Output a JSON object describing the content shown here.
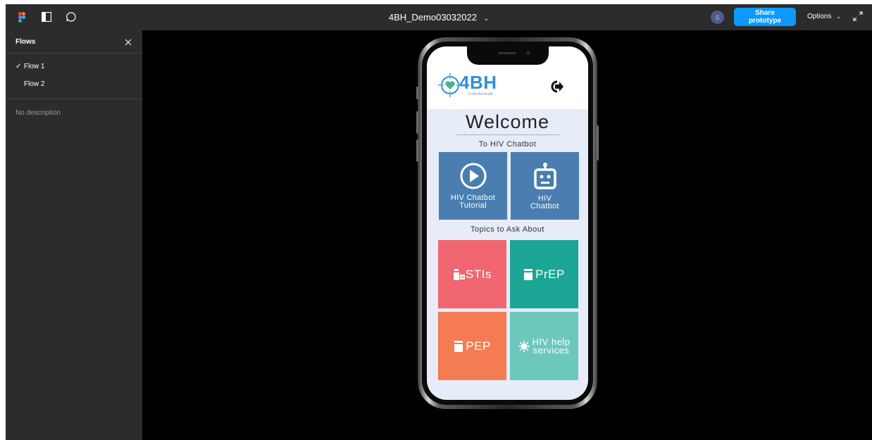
{
  "topbar": {
    "file_title": "4BH_Demo03032022",
    "avatar_initial": "S",
    "share_label": "Share prototype",
    "options_label": "Options"
  },
  "sidebar": {
    "title": "Flows",
    "flows": [
      {
        "label": "Flow 1",
        "selected": true
      },
      {
        "label": "Flow 2",
        "selected": false
      }
    ],
    "description": "No description"
  },
  "app": {
    "logo_text": "4BH",
    "logo_tagline": "ForBetterHealth",
    "welcome_title": "Welcome",
    "welcome_subtitle": "To HIV Chatbot",
    "tutorial_tile": {
      "line1": "HIV Chatbot",
      "line2": "Tutorial"
    },
    "chatbot_tile": {
      "line1": "HIV",
      "line2": "Chatbot"
    },
    "topics_heading": "Topics to Ask About",
    "topics": [
      {
        "label": "STIs",
        "color": "#f06671"
      },
      {
        "label": "PrEP",
        "color": "#1ba595"
      },
      {
        "label": "PEP",
        "color": "#f47b52"
      },
      {
        "label_line1": "HIV help",
        "label_line2": "services",
        "color": "#6cc8bc"
      }
    ]
  },
  "colors": {
    "figma_dark": "#2c2c2c",
    "share_blue": "#0d99ff",
    "tile_blue": "#4a7eb0",
    "screen_bg": "#e6ecf8"
  }
}
